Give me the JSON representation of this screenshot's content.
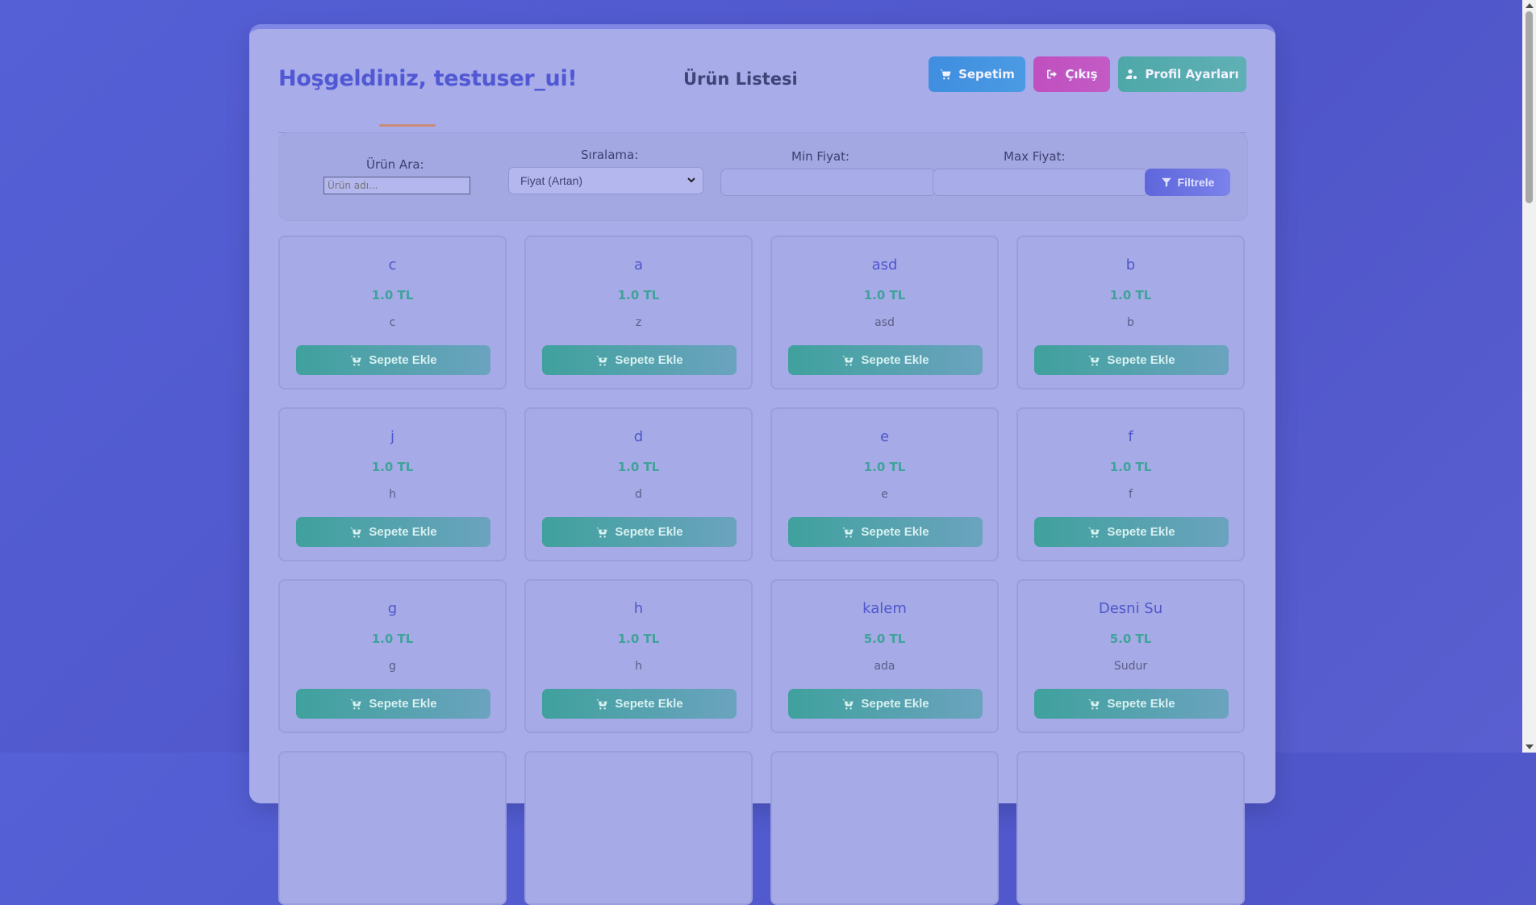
{
  "header": {
    "welcome": "Hoşgeldiniz, testuser_ui!",
    "title": "Ürün Listesi",
    "cart_label": "Sepetim",
    "logout_label": "Çıkış",
    "profile_label": "Profil Ayarları"
  },
  "filters": {
    "search_label": "Ürün Ara:",
    "search_placeholder": "Ürün adı...",
    "sort_label": "Sıralama:",
    "sort_value": "Fiyat (Artan)",
    "min_label": "Min Fiyat:",
    "max_label": "Max Fiyat:",
    "filter_button": "Filtrele"
  },
  "add_button_label": "Sepete Ekle",
  "products": [
    {
      "name": "c",
      "price": "1.0 TL",
      "desc": "c"
    },
    {
      "name": "a",
      "price": "1.0 TL",
      "desc": "z"
    },
    {
      "name": "asd",
      "price": "1.0 TL",
      "desc": "asd"
    },
    {
      "name": "b",
      "price": "1.0 TL",
      "desc": "b"
    },
    {
      "name": "j",
      "price": "1.0 TL",
      "desc": "h"
    },
    {
      "name": "d",
      "price": "1.0 TL",
      "desc": "d"
    },
    {
      "name": "e",
      "price": "1.0 TL",
      "desc": "e"
    },
    {
      "name": "f",
      "price": "1.0 TL",
      "desc": "f"
    },
    {
      "name": "g",
      "price": "1.0 TL",
      "desc": "g"
    },
    {
      "name": "h",
      "price": "1.0 TL",
      "desc": "h"
    },
    {
      "name": "kalem",
      "price": "5.0 TL",
      "desc": "ada"
    },
    {
      "name": "Desni Su",
      "price": "5.0 TL",
      "desc": "Sudur"
    }
  ],
  "icons": {
    "cart": "cart-icon",
    "logout": "sign-out-icon",
    "profile": "user-cog-icon",
    "filter": "filter-icon",
    "add": "cart-plus-icon"
  }
}
